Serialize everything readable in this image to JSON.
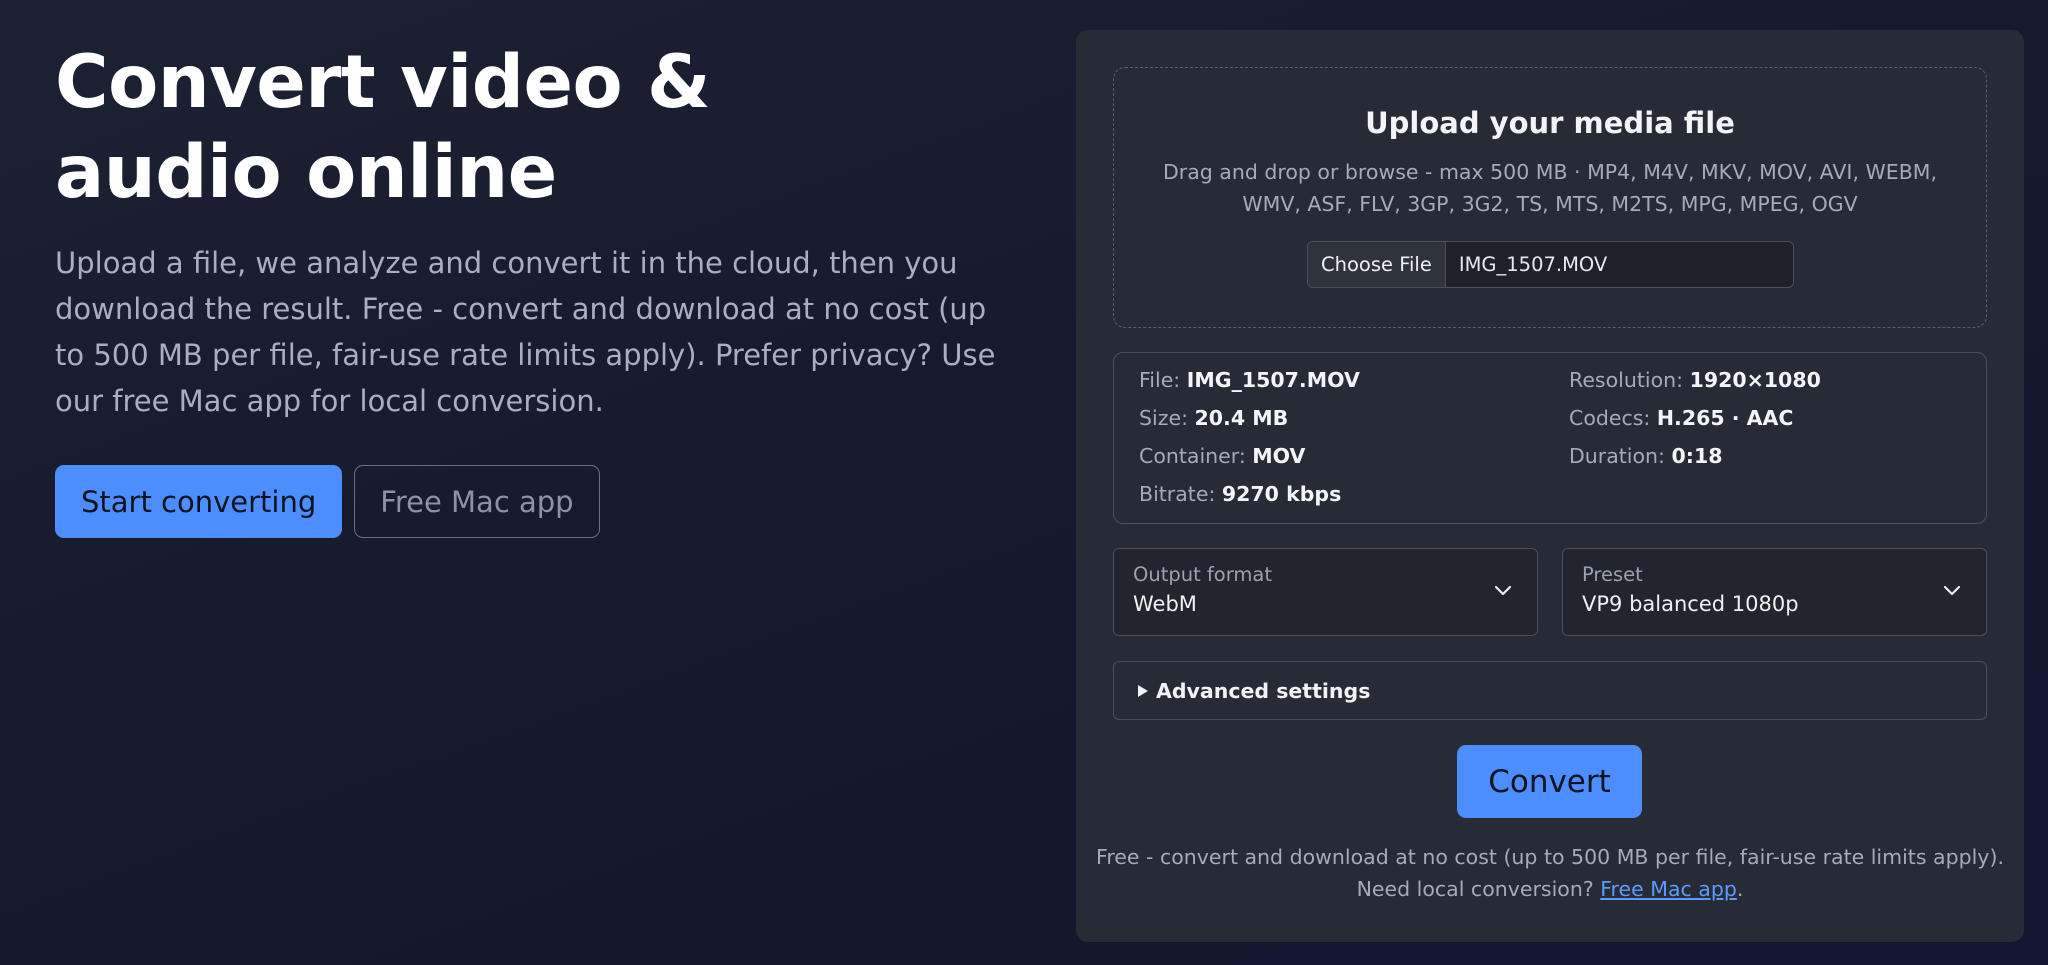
{
  "hero": {
    "title": "Convert video & audio online",
    "lead": "Upload a file, we analyze and convert it in the cloud, then you download the result. Free - convert and download at no cost (up to 500 MB per file, fair-use rate limits apply). Prefer privacy? Use our free Mac app for local conversion.",
    "primary_label": "Start converting",
    "secondary_label": "Free Mac app"
  },
  "upload": {
    "title": "Upload your media file",
    "hint": "Drag and drop or browse - max 500 MB · MP4, M4V, MKV, MOV, AVI, WEBM, WMV, ASF, FLV, 3GP, 3G2, TS, MTS, M2TS, MPG, MPEG, OGV",
    "choose_label": "Choose File",
    "file_name": "IMG_1507.MOV"
  },
  "info": {
    "file": {
      "label": "File:",
      "value": "IMG_1507.MOV"
    },
    "size": {
      "label": "Size:",
      "value": "20.4 MB"
    },
    "container": {
      "label": "Container:",
      "value": "MOV"
    },
    "bitrate": {
      "label": "Bitrate:",
      "value": "9270 kbps"
    },
    "resolution": {
      "label": "Resolution:",
      "value": "1920×1080"
    },
    "codecs": {
      "label": "Codecs:",
      "value": "H.265 · AAC"
    },
    "duration": {
      "label": "Duration:",
      "value": "0:18"
    }
  },
  "output_format": {
    "label": "Output format",
    "value": "WebM"
  },
  "preset": {
    "label": "Preset",
    "value": "VP9 balanced 1080p"
  },
  "advanced": {
    "label": "Advanced settings"
  },
  "convert_label": "Convert",
  "footer": {
    "line1": "Free - convert and download at no cost (up to 500 MB per file, fair-use rate limits apply).",
    "line2_prefix": "Need local conversion?",
    "link": "Free Mac app",
    "line2_suffix": "."
  },
  "colors": {
    "accent": "#4c8dff",
    "panel": "#272b35",
    "link": "#5a9bff"
  }
}
